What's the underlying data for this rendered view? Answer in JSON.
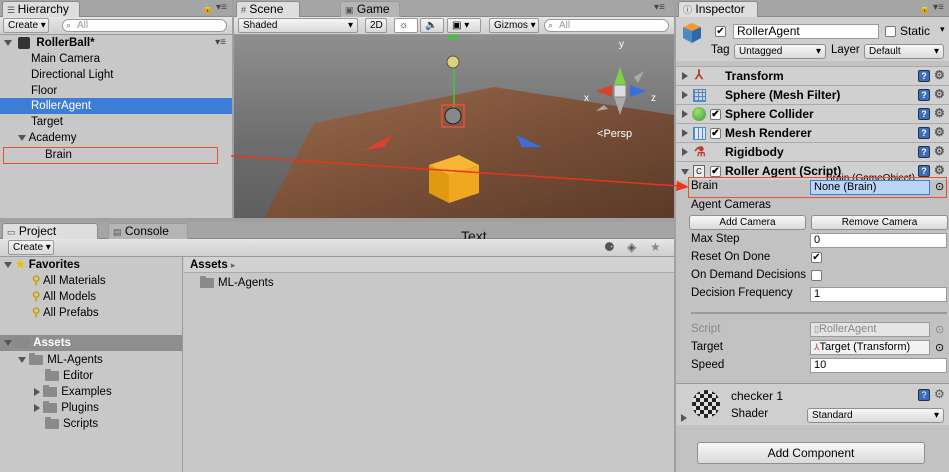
{
  "hierarchy": {
    "tab": "Hierarchy",
    "create": "Create",
    "search_placeholder": "All",
    "scene": "RollerBall*",
    "items": [
      "Main Camera",
      "Directional Light",
      "Floor",
      "RollerAgent",
      "Target",
      "Academy",
      "Brain"
    ]
  },
  "scene_view": {
    "tabs": [
      "Scene",
      "Game"
    ],
    "shading": "Shaded",
    "mode_2d": "2D",
    "gizmos": "Gizmos",
    "search_placeholder": "All",
    "persp": "Persp",
    "axes": {
      "y": "y",
      "x": "x",
      "z": "z"
    }
  },
  "project": {
    "tabs": [
      "Project",
      "Console"
    ],
    "create": "Create",
    "favorites_label": "Favorites",
    "favorites": [
      "All Materials",
      "All Models",
      "All Prefabs"
    ],
    "assets_label": "Assets",
    "tree": [
      "ML-Agents",
      "Editor",
      "Examples",
      "Plugins",
      "Scripts"
    ],
    "breadcrumb": "Assets",
    "assets_items": [
      "ML-Agents"
    ],
    "annotation": "Text"
  },
  "inspector": {
    "tab": "Inspector",
    "object_name": "RollerAgent",
    "static_label": "Static",
    "tag_label": "Tag",
    "tag_value": "Untagged",
    "layer_label": "Layer",
    "layer_value": "Default",
    "components": [
      "Transform",
      "Sphere (Mesh Filter)",
      "Sphere Collider",
      "Mesh Renderer",
      "Rigidbody",
      "Roller Agent (Script)"
    ],
    "brain_label": "Brain",
    "brain_drag_hint": "Brain (GameObject)",
    "brain_value": "None (Brain)",
    "agent_cameras": "Agent Cameras",
    "add_camera": "Add Camera",
    "remove_camera": "Remove Camera",
    "fields": [
      {
        "label": "Max Step",
        "value": "0"
      },
      {
        "label": "Reset On Done",
        "value": "✔"
      },
      {
        "label": "On Demand Decisions",
        "value": ""
      },
      {
        "label": "Decision Frequency",
        "value": "1"
      }
    ],
    "script_label": "Script",
    "script_value": "RollerAgent",
    "target_label": "Target",
    "target_value": "Target (Transform)",
    "speed_label": "Speed",
    "speed_value": "10",
    "material_name": "checker 1",
    "shader_label": "Shader",
    "shader_value": "Standard",
    "add_component": "Add Component"
  },
  "colors": {
    "selection": "#3e7dd6",
    "highlight_box": "#e8503a",
    "arrow": "#e8341c"
  }
}
